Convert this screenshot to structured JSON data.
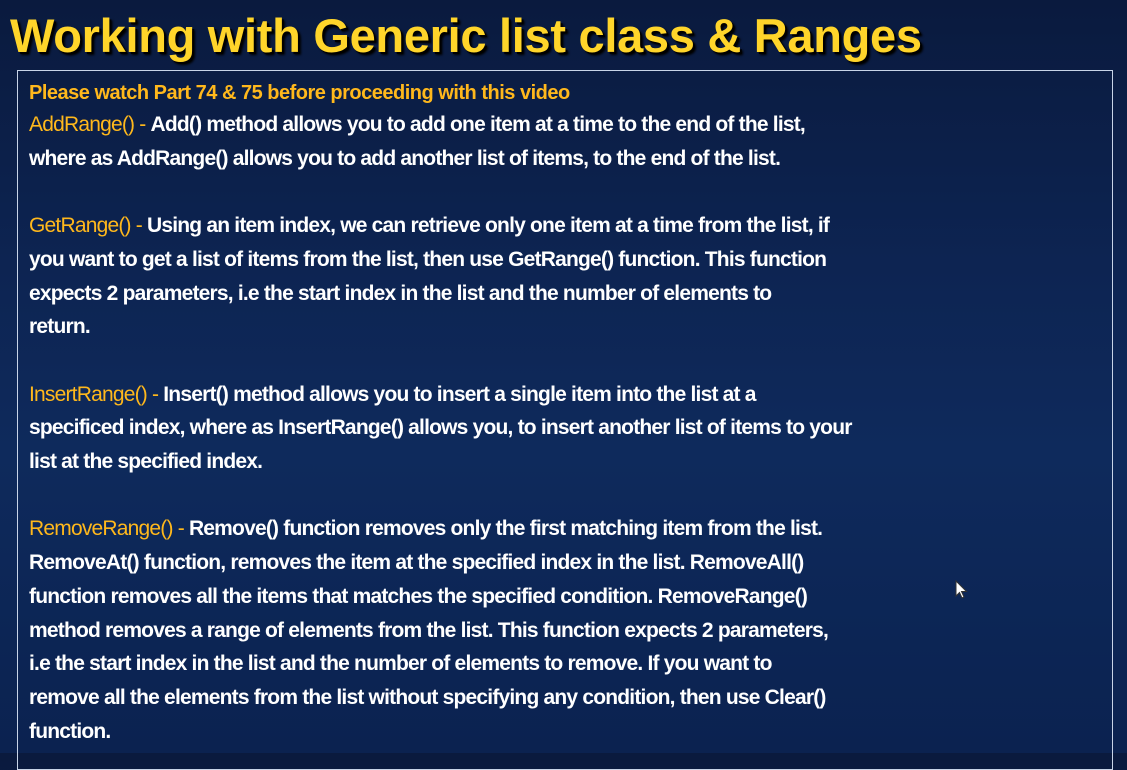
{
  "slide": {
    "title": "Working with Generic list class & Ranges",
    "intro": "Please watch Part 74 & 75 before proceeding with this video",
    "sections": [
      {
        "term": "AddRange() - ",
        "lines": [
          "Add() method allows you to add one item at a time to the end of the list,",
          "where as AddRange() allows you to add another list of items, to the end of the list."
        ]
      },
      {
        "term": "GetRange() - ",
        "lines": [
          "Using an item index, we can retrieve only one item at a time from the list, if",
          "you want to get a list of items from the list, then use GetRange() function. This function",
          "expects 2 parameters, i.e the start index in the list and the number of elements to",
          "return."
        ]
      },
      {
        "term": "InsertRange() - ",
        "lines": [
          "Insert() method allows you to insert a single item into the list at a",
          "specificed index, where as InsertRange() allows you, to insert another list of items to your",
          "list at the specified index."
        ]
      },
      {
        "term": "RemoveRange() - ",
        "lines": [
          "Remove() function removes only the first matching item from the list.",
          "RemoveAt() function, removes the item at the specified index in the list. RemoveAll()",
          "function removes all the items that matches the specified condition. RemoveRange()",
          "method removes a range of elements from the list. This function expects 2 parameters,",
          "i.e the start index in the list and the number of elements to remove. If you want to",
          "remove all the elements from the list without specifying any condition, then use Clear()",
          "function."
        ]
      }
    ]
  },
  "colors": {
    "title": "#ffd52a",
    "term": "#ffb81c",
    "body": "#ffffff",
    "background": "#0d2452"
  },
  "icons": {
    "cursor": "mouse-pointer-icon"
  }
}
